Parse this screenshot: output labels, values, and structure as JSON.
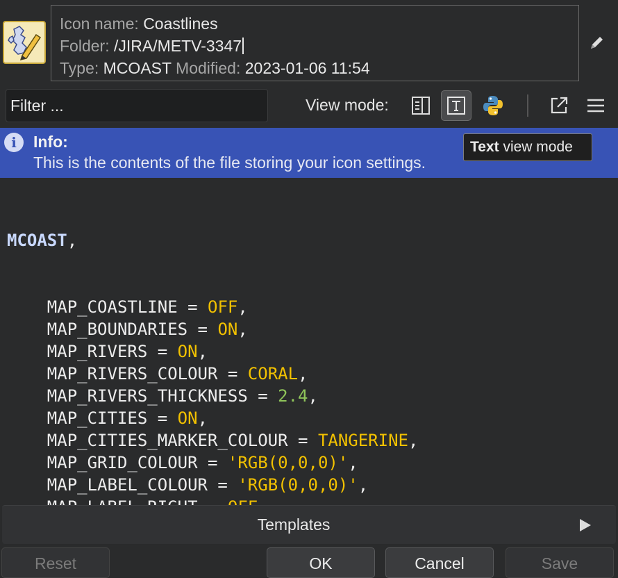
{
  "header": {
    "icon_name_label": "Icon name:",
    "icon_name": "Coastlines",
    "folder_label": "Folder:",
    "folder": "/JIRA/METV-3347",
    "type_label": "Type:",
    "type": "MCOAST",
    "modified_label": "Modified:",
    "modified": "2023-01-06 11:54"
  },
  "toolbar": {
    "filter_placeholder": "Filter ...",
    "view_mode_label": "View mode:"
  },
  "tooltip": {
    "bold": "Text",
    "rest": " view mode"
  },
  "banner": {
    "icon": "i",
    "title": "Info:",
    "text": "This is the contents of the file storing your icon settings."
  },
  "code": {
    "verb": "MCOAST",
    "lines": [
      {
        "key": "MAP_COASTLINE",
        "value": "OFF"
      },
      {
        "key": "MAP_BOUNDARIES",
        "value": "ON"
      },
      {
        "key": "MAP_RIVERS",
        "value": "ON"
      },
      {
        "key": "MAP_RIVERS_COLOUR",
        "value": "CORAL"
      },
      {
        "key": "MAP_RIVERS_THICKNESS",
        "value": "2.4"
      },
      {
        "key": "MAP_CITIES",
        "value": "ON"
      },
      {
        "key": "MAP_CITIES_MARKER_COLOUR",
        "value": "TANGERINE"
      },
      {
        "key": "MAP_GRID_COLOUR",
        "value": "'RGB(0,0,0)'"
      },
      {
        "key": "MAP_LABEL_COLOUR",
        "value": "'RGB(0,0,0)'"
      },
      {
        "key": "MAP_LABEL_RIGHT",
        "value": "OFF"
      }
    ]
  },
  "templates": {
    "label": "Templates"
  },
  "buttons": {
    "reset": "Reset",
    "ok": "OK",
    "cancel": "Cancel",
    "save": "Save"
  },
  "colors": {
    "banner": "#3853b5",
    "keyword": "#c9d9ff",
    "value": "#f2c100",
    "number": "#8fc45a"
  },
  "icons": [
    "map-icon",
    "pencil-icon",
    "standard-view-icon",
    "text-view-icon",
    "python-icon",
    "open-external-icon",
    "menu-icon",
    "info-icon",
    "play-arrow-icon"
  ]
}
